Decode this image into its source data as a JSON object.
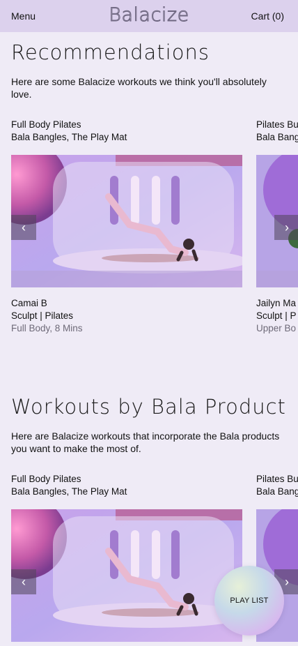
{
  "header": {
    "menu_label": "Menu",
    "logo_text": "Balacize",
    "cart_label": "Cart (0)"
  },
  "sections": [
    {
      "title": "Recommendations",
      "description": "Here are some Balacize workouts we think you'll absolutely love.",
      "cards": [
        {
          "program": "Full Body Pilates",
          "products": "Bala Bangles, The Play Mat",
          "instructor": "Camai B",
          "category": "Sculpt | Pilates",
          "detail": "Full Body, 8 Mins"
        },
        {
          "program": "Pilates Bu",
          "products": "Bala Bang",
          "instructor": "Jailyn Ma",
          "category": "Sculpt | P",
          "detail": "Upper Bo"
        }
      ]
    },
    {
      "title": "Workouts by Bala Product",
      "description": "Here are Balacize workouts that incorporate the Bala products you want to make the most of.",
      "cards": [
        {
          "program": "Full Body Pilates",
          "products": "Bala Bangles, The Play Mat"
        },
        {
          "program": "Pilates Bu",
          "products": "Bala Bang"
        }
      ]
    }
  ],
  "playlist_label": "PLAY LIST",
  "icons": {
    "prev": "chevron-left-icon",
    "next": "chevron-right-icon"
  },
  "colors": {
    "page_background": "#efebf6",
    "header_background": "#dcd1ed",
    "muted_text": "#6e6a78"
  }
}
